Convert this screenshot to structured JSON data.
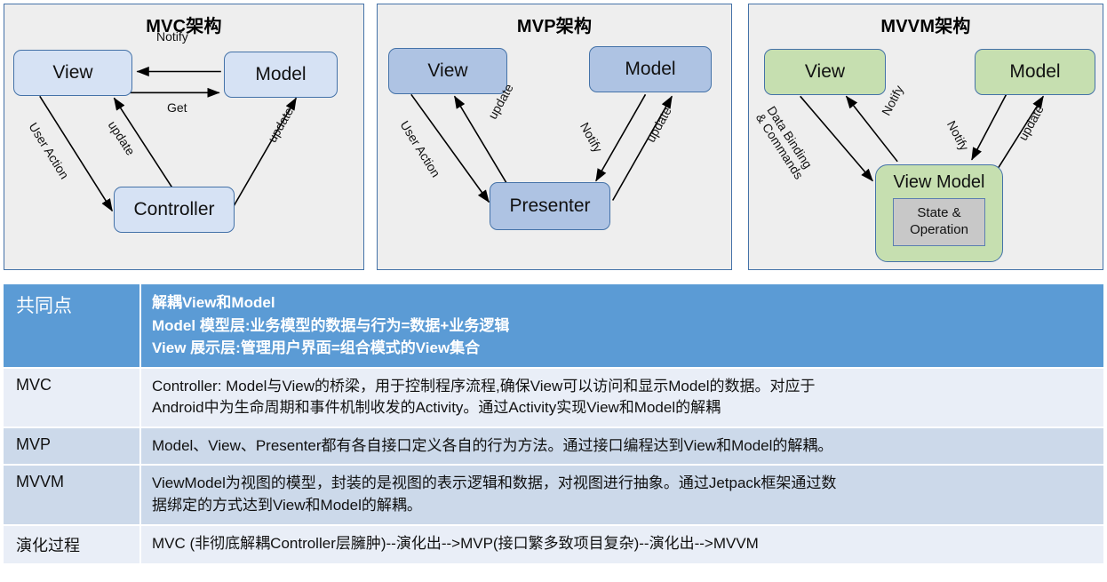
{
  "diagrams": [
    {
      "id": "mvc",
      "title": "MVC架构",
      "nodes": {
        "view": "View",
        "model": "Model",
        "controller": "Controller"
      },
      "edges": [
        {
          "label": "Notify"
        },
        {
          "label": "Get"
        },
        {
          "label": "User Action"
        },
        {
          "label": "update"
        },
        {
          "label": "update"
        }
      ]
    },
    {
      "id": "mvp",
      "title": "MVP架构",
      "nodes": {
        "view": "View",
        "model": "Model",
        "presenter": "Presenter"
      },
      "edges": [
        {
          "label": "User Action"
        },
        {
          "label": "update"
        },
        {
          "label": "Notify"
        },
        {
          "label": "update"
        }
      ]
    },
    {
      "id": "mvvm",
      "title": "MVVM架构",
      "nodes": {
        "view": "View",
        "model": "Model",
        "viewmodel": "View Model",
        "state_line1": "State &",
        "state_line2": "Operation"
      },
      "edges": [
        {
          "label_line1": "Data Binding",
          "label_line2": "& Commands"
        },
        {
          "label": "Notify"
        },
        {
          "label": "Notify"
        },
        {
          "label": "update"
        }
      ]
    }
  ],
  "table": {
    "header": {
      "label": "共同点",
      "lines": [
        "解耦View和Model",
        "Model 模型层:业务模型的数据与行为=数据+业务逻辑",
        "View 展示层:管理用户界面=组合模式的View集合"
      ]
    },
    "rows": [
      {
        "label": "MVC",
        "lines": [
          "Controller: Model与View的桥梁，用于控制程序流程,确保View可以访问和显示Model的数据。对应于",
          "Android中为生命周期和事件机制收发的Activity。通过Activity实现View和Model的解耦"
        ]
      },
      {
        "label": "MVP",
        "lines": [
          "Model、View、Presenter都有各自接口定义各自的行为方法。通过接口编程达到View和Model的解耦。"
        ]
      },
      {
        "label": "MVVM",
        "lines": [
          "ViewModel为视图的模型，封装的是视图的表示逻辑和数据，对视图进行抽象。通过Jetpack框架通过数",
          "据绑定的方式达到View和Model的解耦。"
        ]
      },
      {
        "label": "演化过程",
        "lines": [
          "MVC (非彻底解耦Controller层臃肿)--演化出-->MVP(接口繁多致项目复杂)--演化出-->MVVM"
        ]
      }
    ]
  },
  "colors": {
    "panel_bg": "#eeeeee",
    "panel_border": "#4472a8",
    "node_blue_light": "#d6e2f4",
    "node_blue_mid": "#aec3e3",
    "node_green": "#c6dfb0",
    "state_gray": "#c8c8c8",
    "table_header": "#5b9bd5",
    "table_band_a": "#ccd9ea",
    "table_band_b": "#e9eef7"
  }
}
